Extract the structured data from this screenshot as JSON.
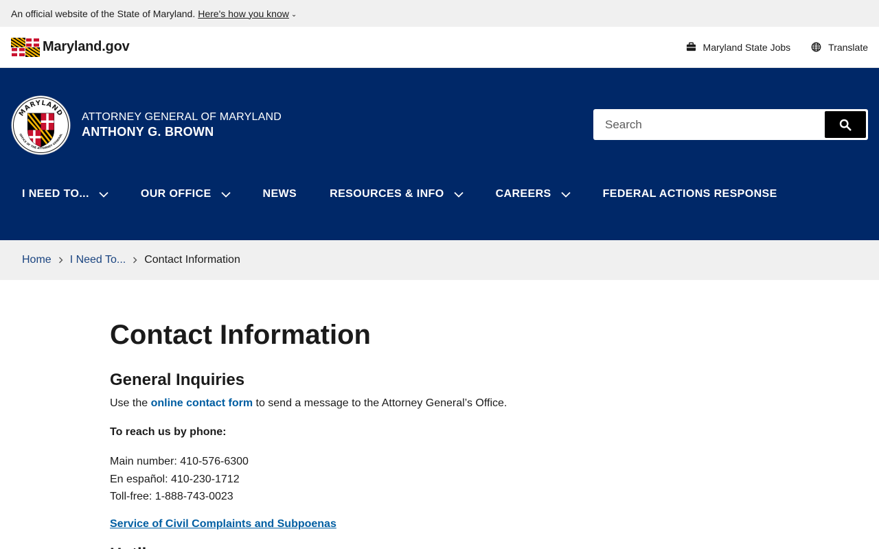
{
  "official_banner": {
    "text": "An official website of the State of Maryland.",
    "link": "Here's how you know"
  },
  "top_bar": {
    "logo_text": "Maryland.gov",
    "jobs_label": "Maryland State Jobs",
    "translate_label": "Translate"
  },
  "agency": {
    "org": "ATTORNEY GENERAL OF MARYLAND",
    "person": "ANTHONY G. BROWN",
    "seal_top_text": "MARYLAND",
    "seal_bottom_text": "OFFICE OF THE ATTORNEY GENERAL"
  },
  "search": {
    "placeholder": "Search"
  },
  "nav": {
    "items": [
      {
        "label": "I NEED TO...",
        "has_dropdown": true
      },
      {
        "label": "OUR OFFICE",
        "has_dropdown": true
      },
      {
        "label": "NEWS",
        "has_dropdown": false
      },
      {
        "label": "RESOURCES & INFO",
        "has_dropdown": true
      },
      {
        "label": "CAREERS",
        "has_dropdown": true
      },
      {
        "label": "FEDERAL ACTIONS RESPONSE",
        "has_dropdown": false
      }
    ]
  },
  "breadcrumb": {
    "home": "Home",
    "parent": "I Need To...",
    "current": "Contact Information"
  },
  "main": {
    "title": "Contact Information",
    "general_heading": "General Inquiries",
    "general_text_before": "Use the ",
    "general_link": "online contact form",
    "general_text_after": " to send a message to the Attorney General’s Office.",
    "phone_heading": "To reach us by phone:",
    "phones": [
      "Main number: 410-576-6300",
      "En español: 410-230-1712",
      "Toll-free: 1-888-743-0023"
    ],
    "service_link": "Service of Civil Complaints and Subpoenas",
    "next_heading": "Hotlines"
  },
  "colors": {
    "navy": "#002868",
    "link_blue": "#005ea2",
    "gray_bar": "#f0f0f0"
  }
}
